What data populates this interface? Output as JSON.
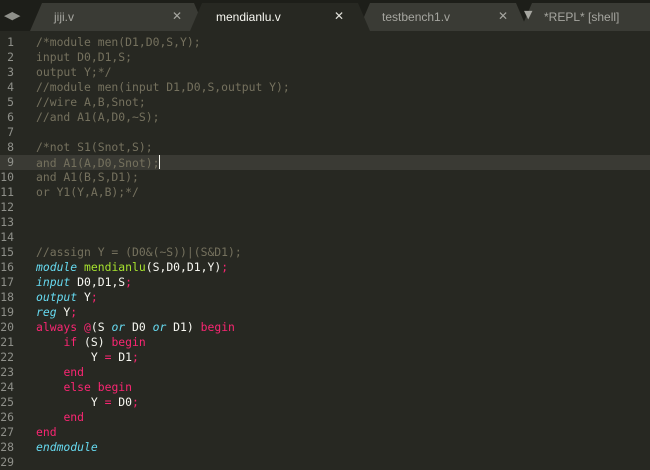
{
  "tabs": [
    {
      "label": "jiji.v",
      "active": false
    },
    {
      "label": "mendianlu.v",
      "active": true
    },
    {
      "label": "testbench1.v",
      "active": false
    },
    {
      "label": "*REPL* [shell]",
      "active": false
    }
  ],
  "nav": {
    "left": "◀",
    "right": "▶"
  },
  "close_glyph": "✕",
  "current_line": 9,
  "lines": [
    [
      {
        "t": "/*module men(D1,D0,S,Y);",
        "c": "cm"
      }
    ],
    [
      {
        "t": "input D0,D1,S;",
        "c": "cm"
      }
    ],
    [
      {
        "t": "output Y;*/",
        "c": "cm"
      }
    ],
    [
      {
        "t": "//module men(input D1,D0,S,output Y);",
        "c": "cm"
      }
    ],
    [
      {
        "t": "//wire A,B,Snot;",
        "c": "cm"
      }
    ],
    [
      {
        "t": "//and A1(A,D0,~S);",
        "c": "cm"
      }
    ],
    [],
    [
      {
        "t": "/*not S1(Snot,S);",
        "c": "cm"
      }
    ],
    [
      {
        "t": "and A1(A,D0,Snot);",
        "c": "cm"
      }
    ],
    [
      {
        "t": "and A1(B,S,D1);",
        "c": "cm"
      }
    ],
    [
      {
        "t": "or Y1(Y,A,B);*/",
        "c": "cm"
      }
    ],
    [],
    [],
    [],
    [
      {
        "t": "//assign Y = (D0&(~S))|(S&D1);",
        "c": "cm"
      }
    ],
    [
      {
        "t": "module",
        "c": "it"
      },
      {
        "t": " ",
        "c": ""
      },
      {
        "t": "mendianlu",
        "c": "fn"
      },
      {
        "t": "(S,D0,D1,Y)",
        "c": ""
      },
      {
        "t": ";",
        "c": "kw"
      }
    ],
    [
      {
        "t": "input",
        "c": "it"
      },
      {
        "t": " D0,D1,S",
        "c": ""
      },
      {
        "t": ";",
        "c": "kw"
      }
    ],
    [
      {
        "t": "output",
        "c": "it"
      },
      {
        "t": " Y",
        "c": ""
      },
      {
        "t": ";",
        "c": "kw"
      }
    ],
    [
      {
        "t": "reg",
        "c": "it"
      },
      {
        "t": " Y",
        "c": ""
      },
      {
        "t": ";",
        "c": "kw"
      }
    ],
    [
      {
        "t": "always",
        "c": "kw"
      },
      {
        "t": " ",
        "c": ""
      },
      {
        "t": "@",
        "c": "kw"
      },
      {
        "t": "(S ",
        "c": ""
      },
      {
        "t": "or",
        "c": "it"
      },
      {
        "t": " D0 ",
        "c": ""
      },
      {
        "t": "or",
        "c": "it"
      },
      {
        "t": " D1) ",
        "c": ""
      },
      {
        "t": "begin",
        "c": "kw"
      }
    ],
    [
      {
        "t": "    ",
        "c": ""
      },
      {
        "t": "if",
        "c": "kw"
      },
      {
        "t": " (S) ",
        "c": ""
      },
      {
        "t": "begin",
        "c": "kw"
      }
    ],
    [
      {
        "t": "        Y ",
        "c": ""
      },
      {
        "t": "=",
        "c": "kw"
      },
      {
        "t": " D1",
        "c": ""
      },
      {
        "t": ";",
        "c": "kw"
      }
    ],
    [
      {
        "t": "    ",
        "c": ""
      },
      {
        "t": "end",
        "c": "kw"
      }
    ],
    [
      {
        "t": "    ",
        "c": ""
      },
      {
        "t": "else",
        "c": "kw"
      },
      {
        "t": " ",
        "c": ""
      },
      {
        "t": "begin",
        "c": "kw"
      }
    ],
    [
      {
        "t": "        Y ",
        "c": ""
      },
      {
        "t": "=",
        "c": "kw"
      },
      {
        "t": " D0",
        "c": ""
      },
      {
        "t": ";",
        "c": "kw"
      }
    ],
    [
      {
        "t": "    ",
        "c": ""
      },
      {
        "t": "end",
        "c": "kw"
      }
    ],
    [
      {
        "t": "end",
        "c": "kw"
      }
    ],
    [
      {
        "t": "endmodule",
        "c": "it"
      }
    ],
    []
  ],
  "colors": {
    "background": "#272822",
    "comment": "#75715e",
    "keyword": "#f92672",
    "type": "#66d9ef",
    "function": "#a6e22e",
    "text": "#f8f8f2"
  }
}
